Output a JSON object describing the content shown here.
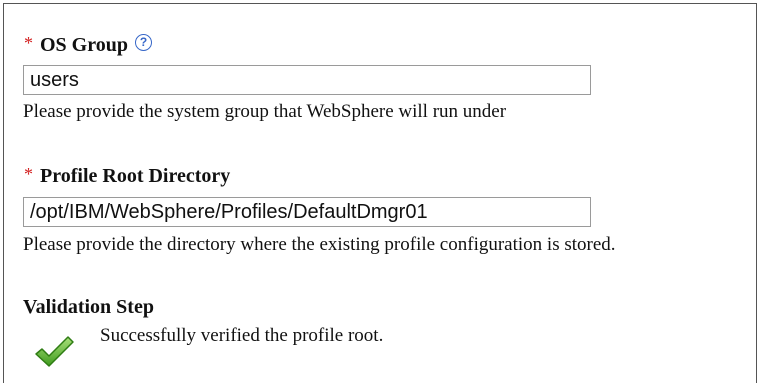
{
  "os_group": {
    "required_marker": "*",
    "label": "OS Group",
    "help_icon": "?",
    "value": "users",
    "description": "Please provide the system group that WebSphere will run under"
  },
  "profile_root": {
    "required_marker": "*",
    "label": "Profile Root Directory",
    "value": "/opt/IBM/WebSphere/Profiles/DefaultDmgr01",
    "description": "Please provide the directory where the existing profile configuration is stored."
  },
  "validation": {
    "heading": "Validation Step",
    "icon": "checkmark-icon",
    "message": "Successfully verified the profile root."
  },
  "colors": {
    "required": "#d32222",
    "help_icon": "#3767c8",
    "check_green": "#5cb82e"
  }
}
